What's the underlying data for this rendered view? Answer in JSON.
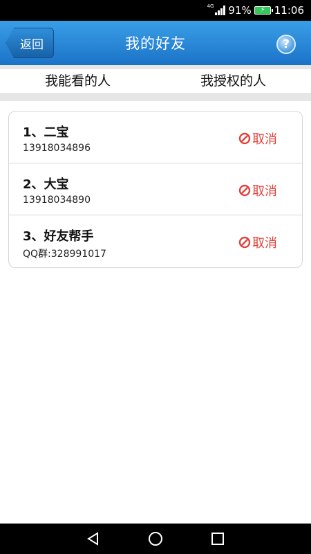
{
  "status_bar": {
    "network": "4G",
    "battery": "91%",
    "time": "11:06"
  },
  "header": {
    "back_label": "返回",
    "title": "我的好友",
    "help_glyph": "?"
  },
  "tabs": [
    {
      "label": "我能看的人",
      "active": true
    },
    {
      "label": "我授权的人",
      "active": false
    }
  ],
  "friends": [
    {
      "name": "1、二宝",
      "id": "13918034896",
      "action": "取消"
    },
    {
      "name": "2、大宝",
      "id": "13918034890",
      "action": "取消"
    },
    {
      "name": "3、好友帮手",
      "id": "QQ群:328991017",
      "action": "取消"
    }
  ],
  "colors": {
    "header_blue": "#2a88d8",
    "tab_indicator": "#4a9de0",
    "cancel_red": "#e0423a"
  },
  "icons": {
    "help": "question-icon",
    "cancel": "prohibit-icon",
    "nav": [
      "back-triangle-icon",
      "home-circle-icon",
      "recents-square-icon"
    ]
  }
}
